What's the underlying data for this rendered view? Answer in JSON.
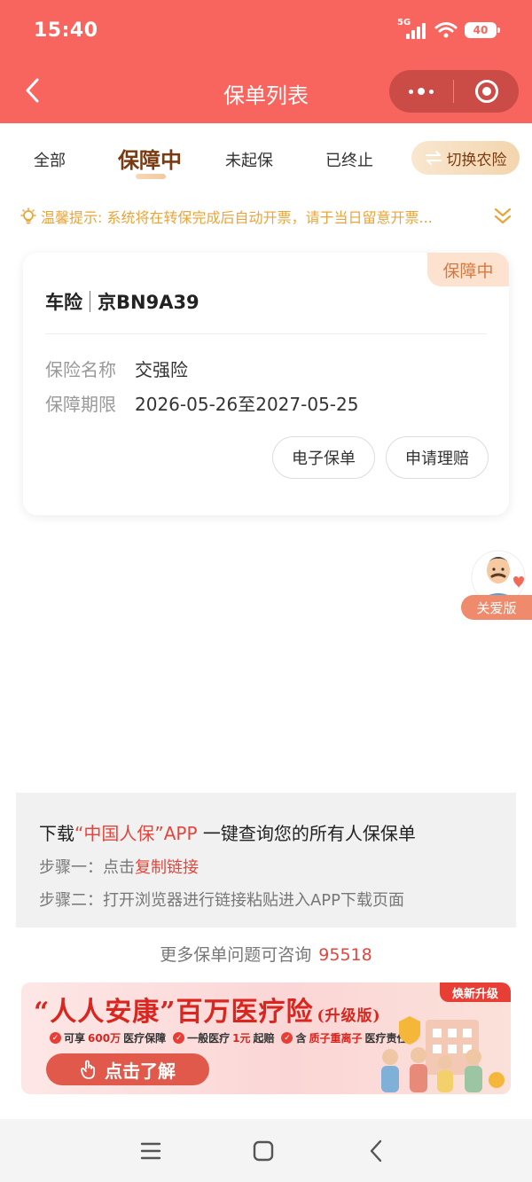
{
  "status_bar": {
    "time": "15:40",
    "network": "5G",
    "battery": "40"
  },
  "nav": {
    "title": "保单列表",
    "icons": [
      "back-icon",
      "more-icon",
      "close-mini-program-icon"
    ]
  },
  "tabs": {
    "items": [
      "全部",
      "保障中",
      "未起保",
      "已终止"
    ],
    "active": "保障中",
    "switch_label": "切换农险"
  },
  "tip": {
    "text": "温馨提示: 系统将在转保完成后自动开票，请于当日留意开票..."
  },
  "policy_card": {
    "status": "保障中",
    "type": "车险",
    "plate": "京BN9A39",
    "name_label": "保险名称",
    "name_value": "交强险",
    "period_label": "保障期限",
    "period_value": "2026-05-26至2027-05-25",
    "btn_epolicy": "电子保单",
    "btn_claim": "申请理赔"
  },
  "care": {
    "label": "关爱版"
  },
  "download": {
    "prefix": "下载",
    "app_name": "“中国人保”APP",
    "suffix": " 一键查询您的所有人保保单",
    "step1_prefix": "步骤一：点击",
    "step1_link": "复制链接",
    "step2": "步骤二：打开浏览器进行链接粘贴进入APP下载页面"
  },
  "consult": {
    "text": "更多保单问题可咨询",
    "phone": "95518"
  },
  "banner": {
    "title": "“人人安康”百万医疗险",
    "subtitle": "(升级版)",
    "tag": "焕新升级",
    "feature1_a": "可享",
    "feature1_hl": "600万",
    "feature1_b": "医疗保障",
    "feature2_a": "一般医疗",
    "feature2_hl": "1元",
    "feature2_b": "起赔",
    "feature3_a": "含",
    "feature3_hl": "质子重离子",
    "feature3_b": "医疗责任",
    "button": "点击了解"
  },
  "colors": {
    "header": "#f8655f",
    "active_tab": "#7a3b12",
    "tip": "#e9a43a",
    "accent_red": "#e2463c"
  }
}
